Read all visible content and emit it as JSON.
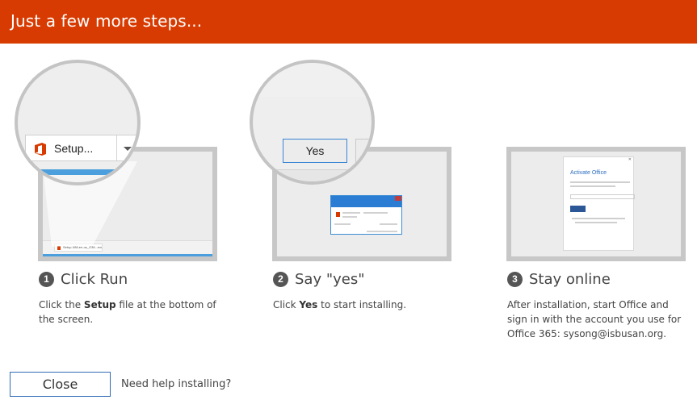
{
  "header": {
    "title": "Just a few more steps..."
  },
  "steps": [
    {
      "number": "1",
      "title": "Click Run",
      "desc_prefix": "Click the ",
      "desc_bold": "Setup",
      "desc_suffix": " file at the bottom of the screen.",
      "illustration": {
        "button_label": "Setup...",
        "taskbar_item": "Setup.X86.en-us_O36...exe"
      }
    },
    {
      "number": "2",
      "title": "Say \"yes\"",
      "desc_prefix": "Click ",
      "desc_bold": "Yes",
      "desc_suffix": " to start installing.",
      "illustration": {
        "yes_label": "Yes"
      }
    },
    {
      "number": "3",
      "title": "Stay online",
      "desc": "After installation, start Office and sign in with the account you use for Office 365: sysong@isbusan.org.",
      "illustration": {
        "card_title": "Activate Office"
      }
    }
  ],
  "footer": {
    "close_label": "Close",
    "help_label": "Need help installing?"
  },
  "colors": {
    "header_bg": "#d83b01",
    "accent_blue": "#2f6cb5"
  }
}
